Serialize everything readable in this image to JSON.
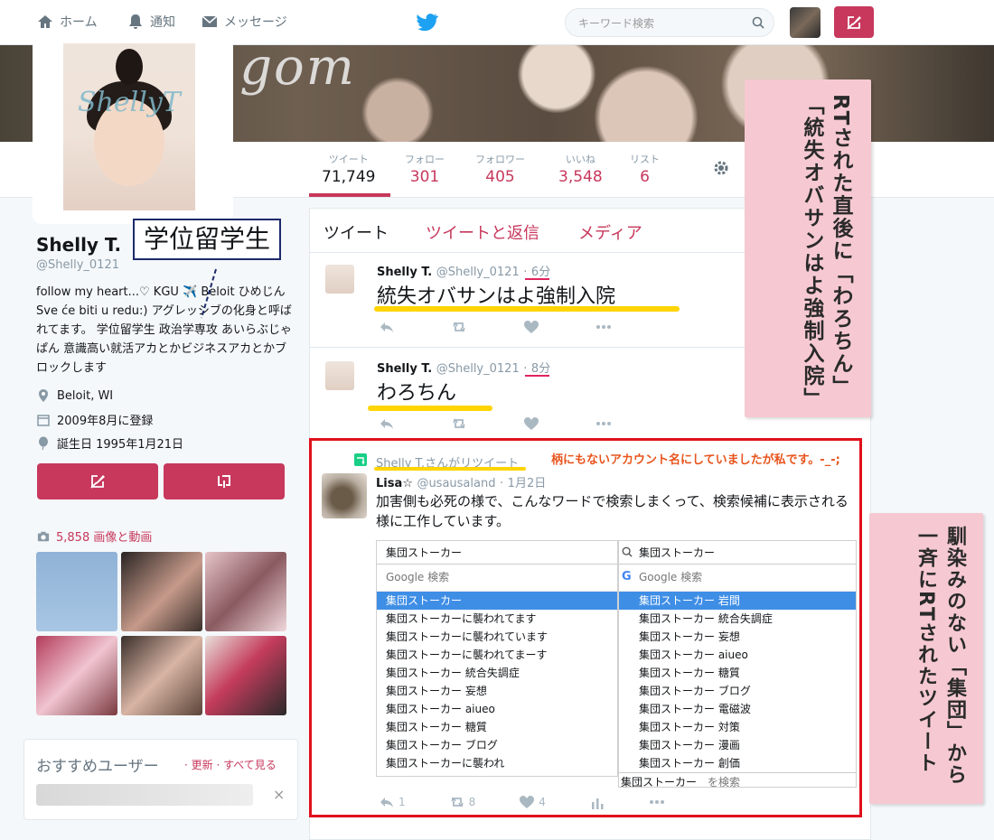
{
  "nav": {
    "home": "ホーム",
    "notifications": "通知",
    "messages": "メッセージ",
    "search_placeholder": "キーワード検索"
  },
  "colors": {
    "accent": "#c7385c",
    "twitter_blue": "#1da1f2",
    "highlight": "#ffd400",
    "red_frame": "#e0101c"
  },
  "banner_text": "a gom",
  "photo_watermark": "ShellyT",
  "stats": [
    {
      "label": "ツイート",
      "value": "71,749"
    },
    {
      "label": "フォロー",
      "value": "301"
    },
    {
      "label": "フォロワー",
      "value": "405"
    },
    {
      "label": "いいね",
      "value": "3,548"
    },
    {
      "label": "リスト",
      "value": "6"
    }
  ],
  "profile": {
    "name": "Shelly T.",
    "handle": "@Shelly_0121",
    "bio": "follow my heart...♡ KGU ✈️ Beloit ひめじん Sve će biti u redu:) アグレッシブの化身と呼ばれてます。 学位留学生 政治学専攻 あいらぶじゃぱん 意識高い就活アカとかビジネスアカとかブロックします",
    "location": "Beloit, WI",
    "joined": "2009年8月に登録",
    "birthday": "誕生日 1995年1月21日"
  },
  "media": {
    "label": "5,858 画像と動画"
  },
  "suggestions": {
    "title": "おすすめユーザー",
    "links": "· 更新 · すべて見る"
  },
  "tabs": [
    "ツイート",
    "ツイートと返信",
    "メディア"
  ],
  "tweets": [
    {
      "name": "Shelly T.",
      "handle": "@Shelly_0121",
      "time": "6分",
      "text": "統失オバサンはよ強制入院"
    },
    {
      "name": "Shelly T.",
      "handle": "@Shelly_0121",
      "time": "8分",
      "text": "わろちん"
    }
  ],
  "retweet": {
    "label": "Shelly T.さんがリツイート",
    "note": "柄にもないアカウント名にしていましたが私です。-_-;",
    "name": "Lisa☆",
    "handle": "@usausaland",
    "time": "1月2日",
    "text": "加害側も必死の様で、こんなワードで検索しまくって、検索候補に表示される様に工作しています。",
    "counts": {
      "retweets": "8",
      "likes": "4",
      "replies": "1"
    }
  },
  "autocomplete_left": {
    "input": "集団ストーカー",
    "header": "Google 検索",
    "items": [
      "集団ストーカー",
      "集団ストーカーに襲われてます",
      "集団ストーカーに襲われています",
      "集団ストーカーに襲われてまーす",
      "集団ストーカー 統合失調症",
      "集団ストーカー 妄想",
      "集団ストーカー aiueo",
      "集団ストーカー 糖質",
      "集団ストーカー ブログ",
      "集団ストーカーに襲われ"
    ]
  },
  "autocomplete_right": {
    "input": "集団ストーカー",
    "header": "Google 検索",
    "items": [
      "集団ストーカー 岩間",
      "集団ストーカー 統合失調症",
      "集団ストーカー 妄想",
      "集団ストーカー aiueo",
      "集団ストーカー 糖質",
      "集団ストーカー ブログ",
      "集団ストーカー 電磁波",
      "集団ストーカー 対策",
      "集団ストーカー 漫画",
      "集団ストーカー 創価"
    ],
    "footer_term": "集団ストーカー",
    "footer_suffix": "を検索"
  },
  "annotations": {
    "callout": "学位留学生",
    "note_top": "RTされた直後に「わろちん」「統失オバサンはよ強制入院」",
    "note_bottom": "馴染みのない「集団」から一斉にRTされたツイート"
  }
}
